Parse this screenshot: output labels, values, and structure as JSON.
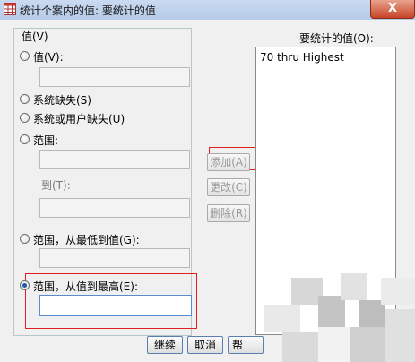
{
  "window": {
    "title": "统计个案内的值: 要统计的值",
    "close_label": "X"
  },
  "group": {
    "legend": "值(V)"
  },
  "options": {
    "value": "值(V):",
    "system_missing": "系统缺失(S)",
    "system_or_user_missing": "系统或用户缺失(U)",
    "range": "范围:",
    "range_to": "到(T):",
    "range_lowest": "范围，从最低到值(G):",
    "range_highest": "范围，从值到最高(E):"
  },
  "selected_option": "range_highest",
  "buttons": {
    "add": "添加(A)",
    "change": "更改(C)",
    "remove": "删除(R)",
    "continue": "继续",
    "cancel": "取消",
    "help": "帮"
  },
  "values_list": {
    "title": "要统计的值(O):",
    "items": [
      "70 thru Highest"
    ]
  },
  "colors": {
    "highlight_border": "#e02020",
    "selected_radio": "#1e58a8"
  }
}
